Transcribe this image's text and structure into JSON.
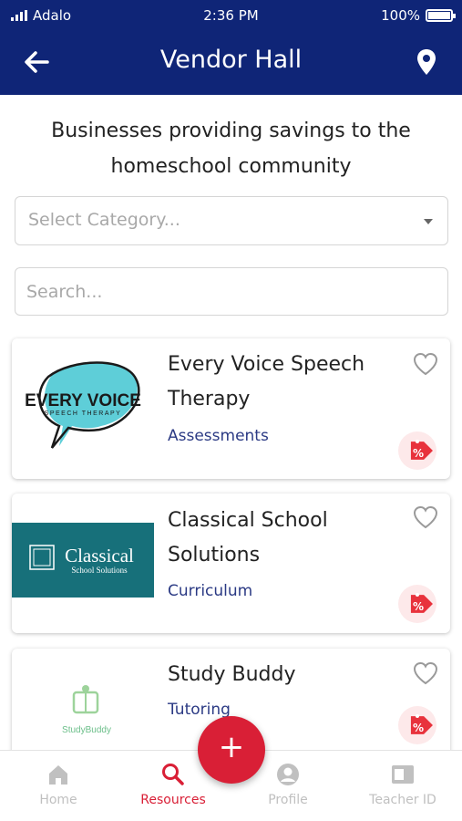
{
  "status_bar": {
    "carrier": "Adalo",
    "time": "2:36 PM",
    "battery": "100%"
  },
  "header": {
    "title": "Vendor Hall",
    "back_icon": "arrow-left-icon",
    "map_icon": "map-pin-icon",
    "bg_color": "#0f2577"
  },
  "intro": {
    "subtitle": "Businesses providing savings to the homeschool community"
  },
  "filters": {
    "category_placeholder": "Select Category...",
    "search_placeholder": "Search..."
  },
  "vendors": [
    {
      "name": "Every Voice Speech Therapy",
      "category": "Assessments",
      "logo_text": "EVERY VOICE",
      "logo_sub": "SPEECH THERAPY"
    },
    {
      "name": "Classical School Solutions",
      "category": "Curriculum",
      "logo_text": "Classical",
      "logo_sub": "School Solutions"
    },
    {
      "name": "Study Buddy",
      "category": "Tutoring",
      "logo_text": "StudyBuddy"
    }
  ],
  "bottom_nav": {
    "items": [
      {
        "label": "Home",
        "icon": "home-icon"
      },
      {
        "label": "Resources",
        "icon": "search-icon",
        "active": true
      },
      {
        "label": "Profile",
        "icon": "profile-icon"
      },
      {
        "label": "Teacher ID",
        "icon": "id-card-icon"
      }
    ],
    "fab_label": "+"
  },
  "colors": {
    "accent": "#d91f36",
    "category_text": "#2b3a84"
  }
}
